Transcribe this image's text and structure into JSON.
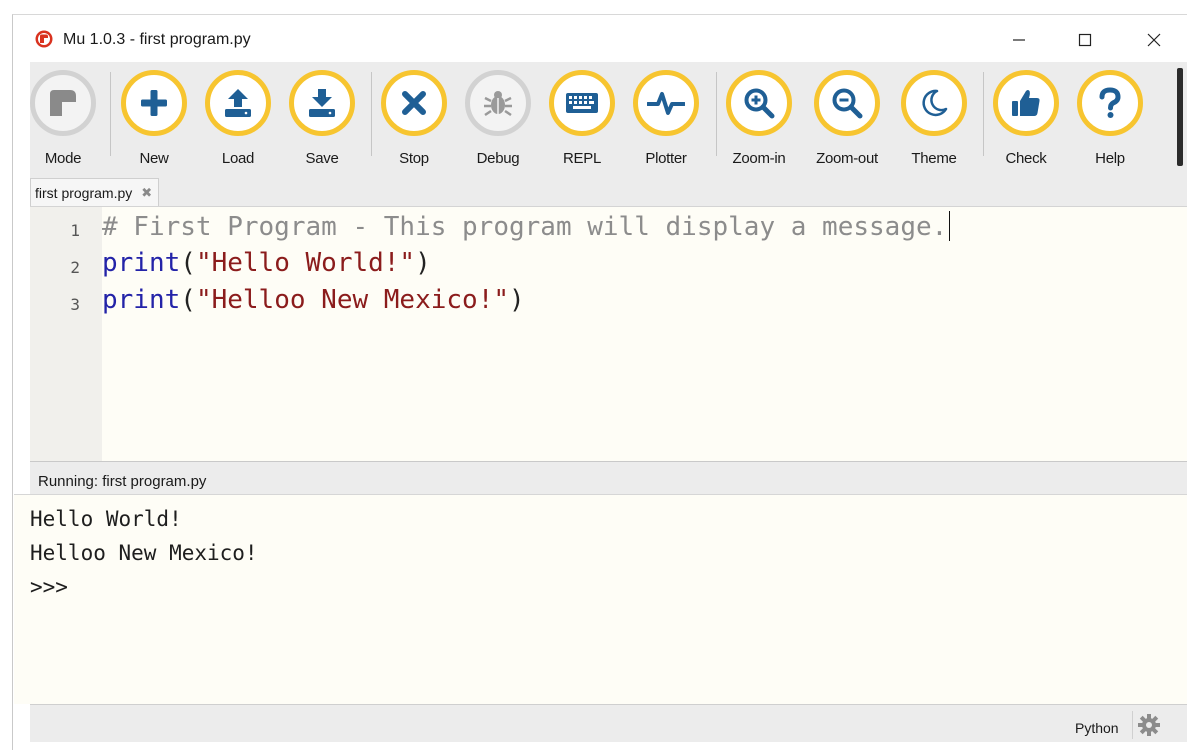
{
  "window": {
    "title": "Mu 1.0.3 - first program.py"
  },
  "toolbar": {
    "buttons": [
      {
        "id": "mode",
        "label": "Mode",
        "icon": "mode-icon"
      },
      {
        "id": "new",
        "label": "New",
        "icon": "plus-icon"
      },
      {
        "id": "load",
        "label": "Load",
        "icon": "upload-icon"
      },
      {
        "id": "save",
        "label": "Save",
        "icon": "download-icon"
      },
      {
        "id": "stop",
        "label": "Stop",
        "icon": "x-icon"
      },
      {
        "id": "debug",
        "label": "Debug",
        "icon": "bug-icon"
      },
      {
        "id": "repl",
        "label": "REPL",
        "icon": "keyboard-icon"
      },
      {
        "id": "plotter",
        "label": "Plotter",
        "icon": "pulse-icon"
      },
      {
        "id": "zoomin",
        "label": "Zoom-in",
        "icon": "zoom-in-icon"
      },
      {
        "id": "zoomout",
        "label": "Zoom-out",
        "icon": "zoom-out-icon"
      },
      {
        "id": "theme",
        "label": "Theme",
        "icon": "moon-icon"
      },
      {
        "id": "check",
        "label": "Check",
        "icon": "thumbs-up-icon"
      },
      {
        "id": "help",
        "label": "Help",
        "icon": "question-icon"
      }
    ]
  },
  "tabs": [
    {
      "label": "first program.py",
      "close": "✖"
    }
  ],
  "editor": {
    "lines": [
      {
        "num": "1",
        "comment": "# First Program - This program will display a message."
      },
      {
        "num": "2",
        "kw": "print",
        "open": "(",
        "str": "\"Hello World!\"",
        "close": ")"
      },
      {
        "num": "3",
        "kw": "print",
        "open": "(",
        "str": "\"Helloo New Mexico!\"",
        "close": ")"
      }
    ]
  },
  "runner": {
    "title": "Running: first program.py",
    "output": [
      "Hello World!",
      "Helloo New Mexico!",
      ">>>"
    ]
  },
  "statusbar": {
    "mode": "Python",
    "settings_icon": "gear-icon"
  },
  "colors": {
    "accent": "#f7c530",
    "icon_blue": "#1f5f95"
  }
}
